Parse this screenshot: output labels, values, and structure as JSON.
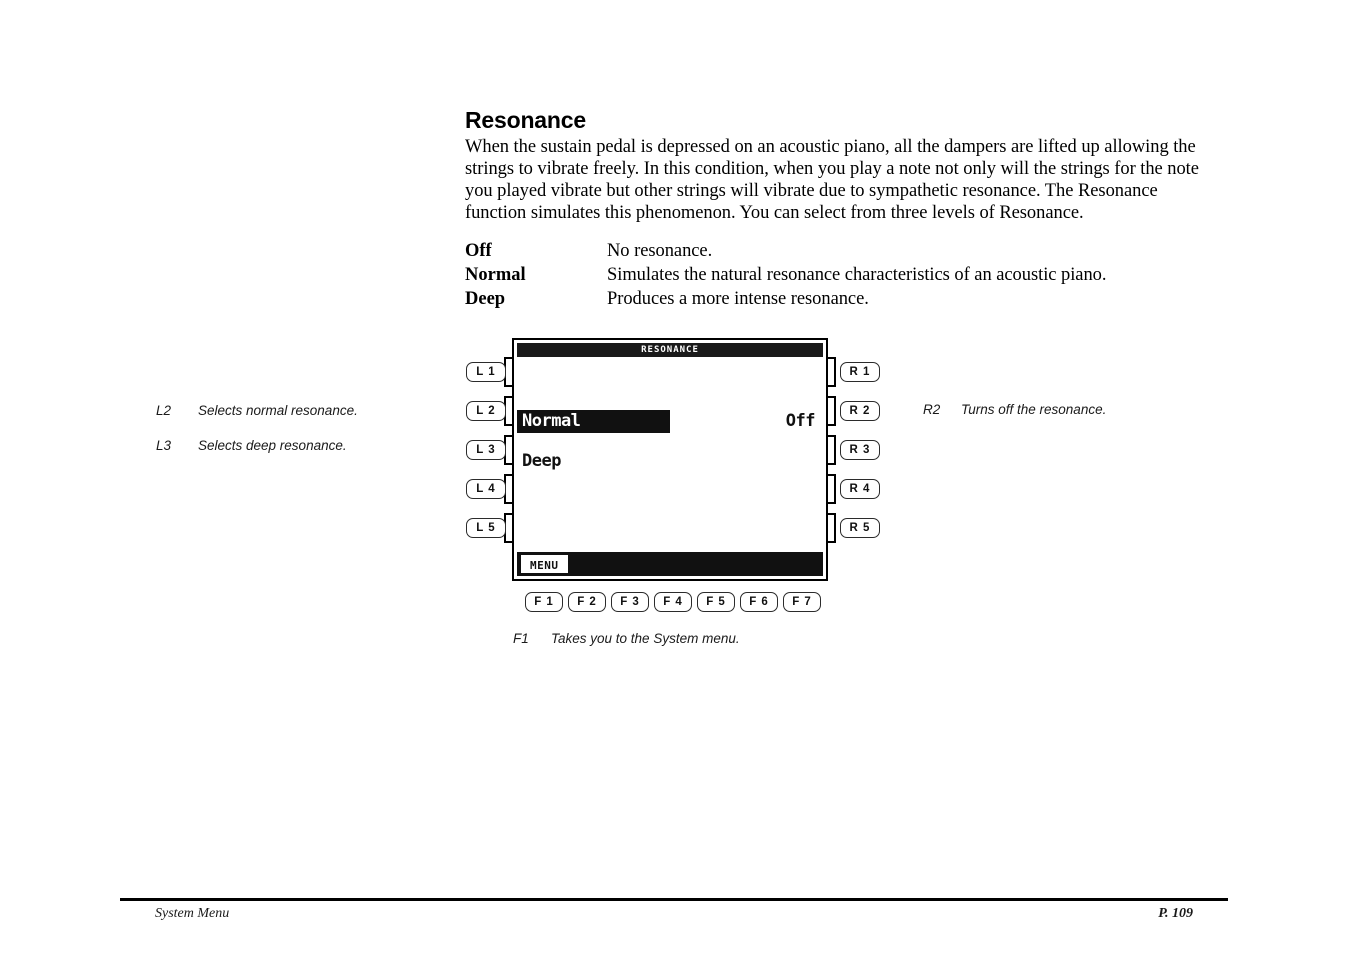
{
  "page": {
    "heading": "Resonance",
    "intro": "When the sustain pedal is depressed on an acoustic piano, all the dampers are lifted up allowing the strings to vibrate freely.  In this condition, when you play a note not only will the strings for the note you played vibrate but other strings will vibrate due to sympathetic resonance.  The Resonance function simulates this phenomenon.  You can select from three levels of Resonance."
  },
  "definitions": [
    {
      "term": "Off",
      "desc": "No resonance."
    },
    {
      "term": "Normal",
      "desc": "Simulates the natural resonance characteristics of an acoustic piano."
    },
    {
      "term": "Deep",
      "desc": "Produces a more intense resonance."
    }
  ],
  "annotations": {
    "l2": {
      "key": "L2",
      "text": "Selects normal resonance."
    },
    "l3": {
      "key": "L3",
      "text": "Selects deep resonance."
    },
    "r2": {
      "key": "R2",
      "text": "Turns off the resonance."
    },
    "f1": {
      "key": "F1",
      "text": "Takes you to the System menu."
    }
  },
  "lcd": {
    "title": "RESONANCE",
    "selected_item": "Normal",
    "second_item": "Deep",
    "right_value": "Off",
    "footer_tab": "MENU"
  },
  "buttons": {
    "left": [
      "L 1",
      "L 2",
      "L 3",
      "L 4",
      "L 5"
    ],
    "right": [
      "R 1",
      "R 2",
      "R 3",
      "R 4",
      "R 5"
    ],
    "function": [
      "F 1",
      "F 2",
      "F 3",
      "F 4",
      "F 5",
      "F 6",
      "F 7"
    ]
  },
  "footer": {
    "section": "System Menu",
    "page": "P. 109"
  },
  "colors": {
    "ink": "#000000",
    "lcd_background": "#ffffff",
    "lcd_highlight": "#111111",
    "lcd_highlight_text": "#ffffff"
  }
}
